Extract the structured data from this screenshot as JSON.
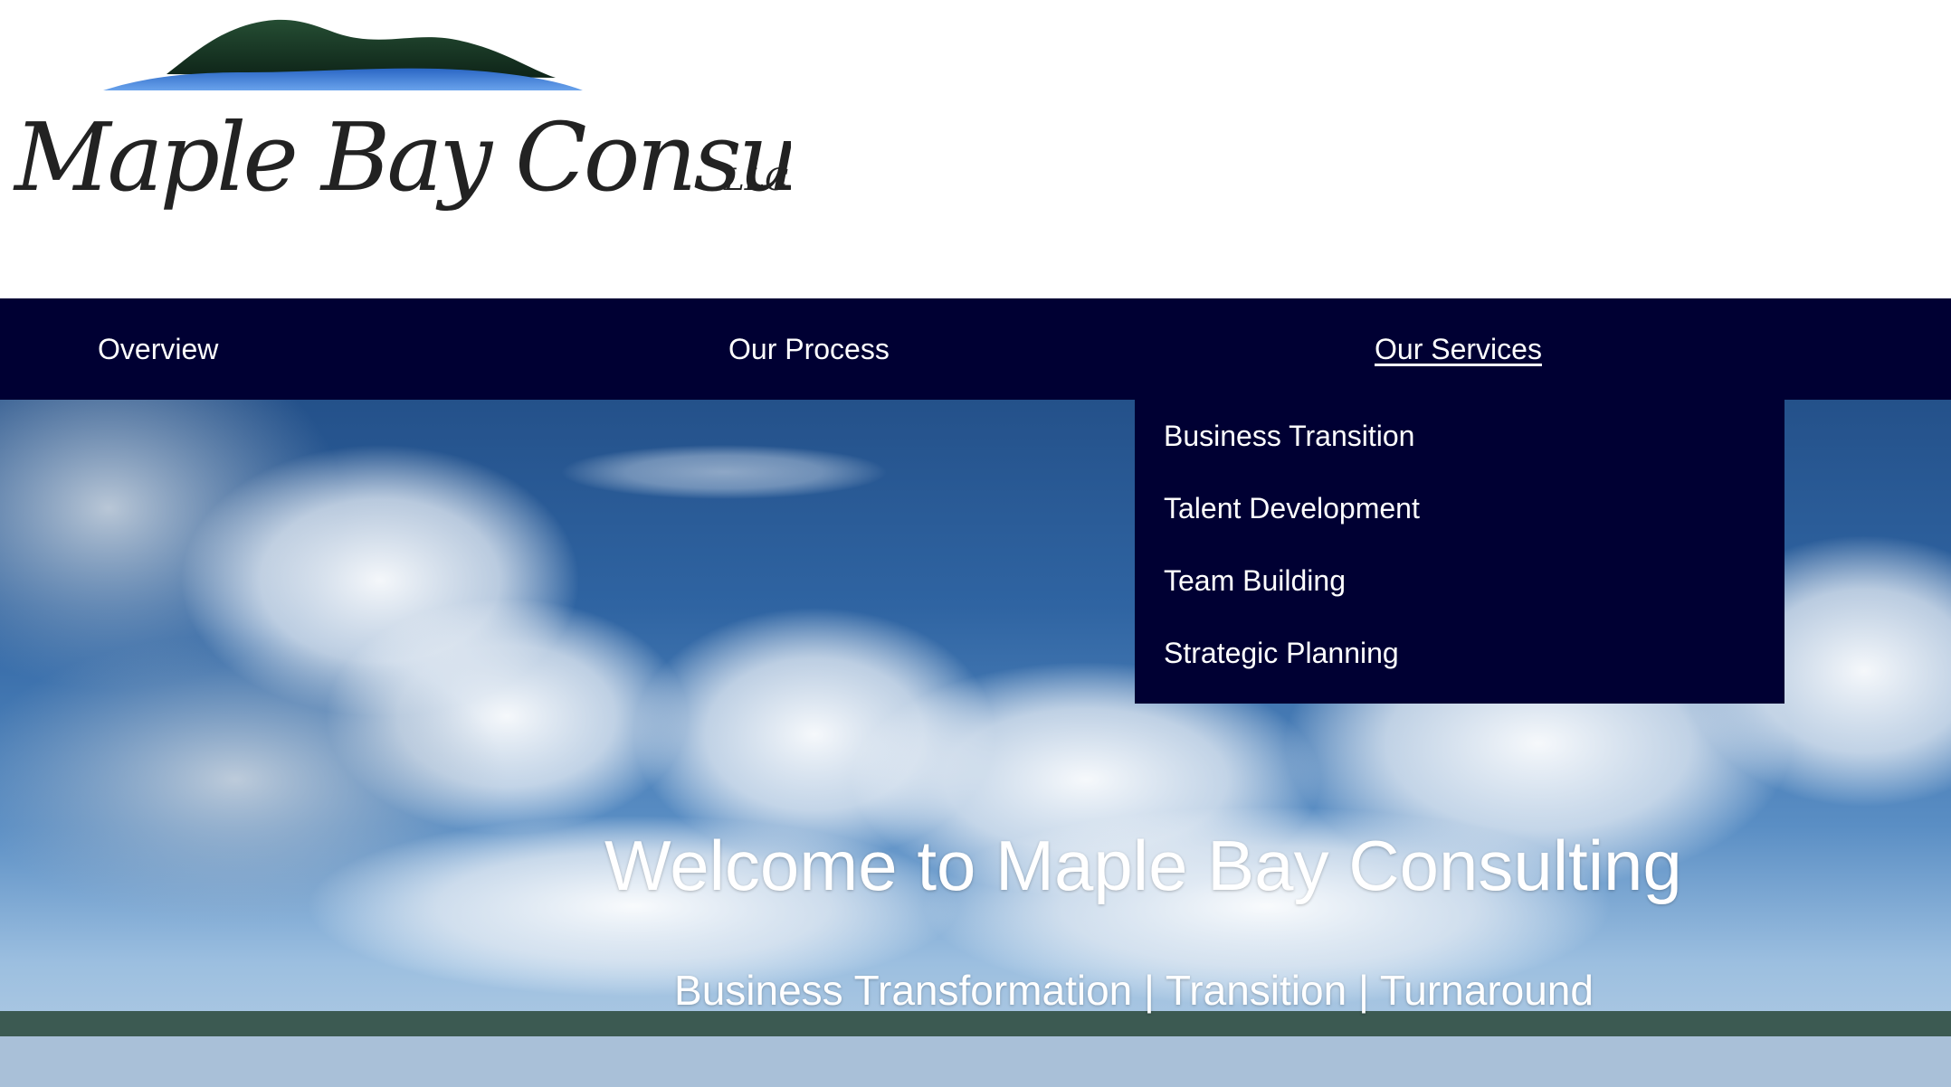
{
  "logo": {
    "name": "Maple Bay Consulting",
    "suffix": "LLC"
  },
  "nav": {
    "items": [
      {
        "label": "Overview"
      },
      {
        "label": "Our Process"
      },
      {
        "label": "Our Services"
      }
    ],
    "active": "Our Services"
  },
  "dropdown": {
    "items": [
      {
        "label": "Business Transition"
      },
      {
        "label": "Talent Development"
      },
      {
        "label": "Team Building"
      },
      {
        "label": "Strategic Planning"
      }
    ]
  },
  "hero": {
    "title": "Welcome to Maple Bay Consulting",
    "subtitle": "Business Transformation | Transition | Turnaround"
  },
  "colors": {
    "nav_background": "#000033",
    "nav_text": "#ffffff",
    "logo_mountain": "#1f4a2c",
    "logo_water": "#3f7fd6",
    "logo_text": "#222222"
  }
}
